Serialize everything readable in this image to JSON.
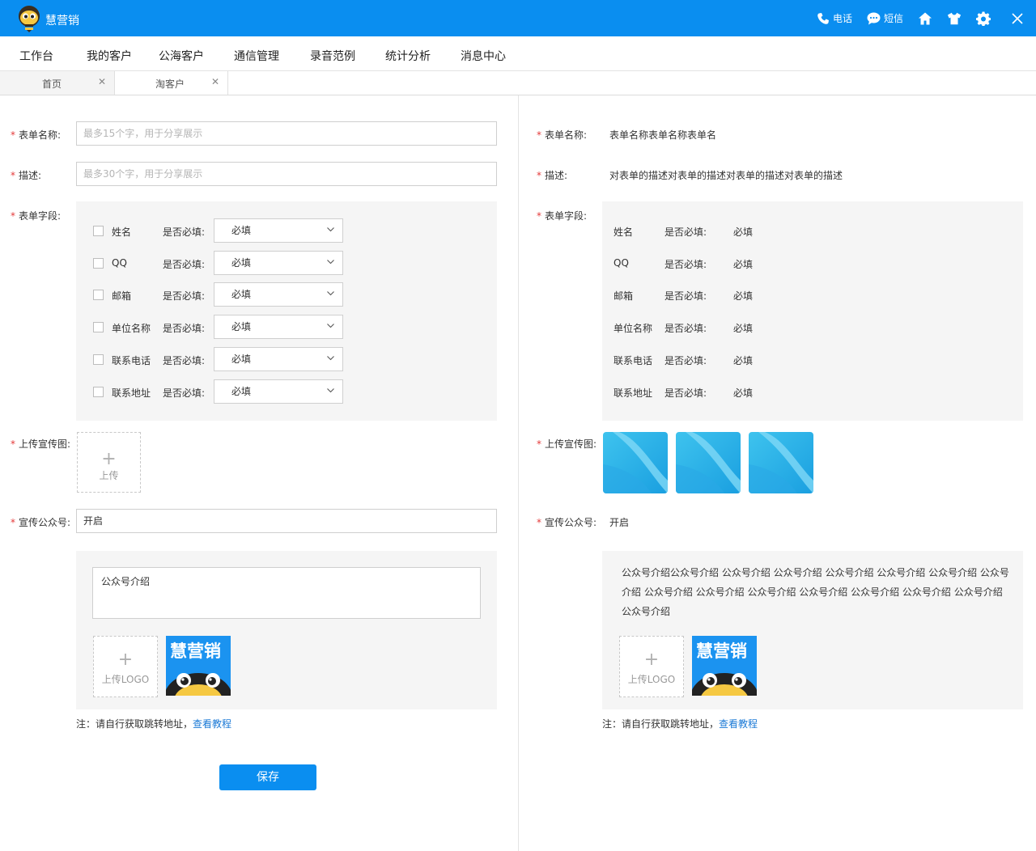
{
  "app": {
    "title": "慧营销"
  },
  "titlebar": {
    "phone_label": "电话",
    "sms_label": "短信",
    "colors": {
      "primary": "#0a8ef0"
    }
  },
  "nav": {
    "items": [
      "工作台",
      "我的客户",
      "公海客户",
      "通信管理",
      "录音范例",
      "统计分析",
      "消息中心"
    ]
  },
  "tabs": [
    {
      "label": "首页"
    },
    {
      "label": "淘客户"
    }
  ],
  "form": {
    "name_label": "表单名称:",
    "name_placeholder": "最多15个字，用于分享展示",
    "desc_label": "描述:",
    "desc_placeholder": "最多30个字，用于分享展示",
    "fields_label": "表单字段:",
    "required_label": "是否必填:",
    "fields": [
      {
        "name": "姓名",
        "required": "必填"
      },
      {
        "name": "QQ",
        "required": "必填"
      },
      {
        "name": "邮箱",
        "required": "必填"
      },
      {
        "name": "单位名称",
        "required": "必填"
      },
      {
        "name": "联系电话",
        "required": "必填"
      },
      {
        "name": "联系地址",
        "required": "必填"
      }
    ],
    "upload_label": "上传宣传图:",
    "upload_text": "上传",
    "public_label": "宣传公众号:",
    "public_value": "开启",
    "intro_value": "公众号介绍",
    "upload_logo_text": "上传LOGO",
    "logo_text": "慧营销",
    "note_text": "注：请自行获取跳转地址，",
    "note_link": "查看教程",
    "save_label": "保存"
  },
  "preview": {
    "name_label": "表单名称:",
    "name_value": "表单名称表单名称表单名",
    "desc_label": "描述:",
    "desc_value": "对表单的描述对表单的描述对表单的描述对表单的描述",
    "fields_label": "表单字段:",
    "required_label": "是否必填:",
    "fields": [
      {
        "name": "姓名",
        "required": "必填"
      },
      {
        "name": "QQ",
        "required": "必填"
      },
      {
        "name": "邮箱",
        "required": "必填"
      },
      {
        "name": "单位名称",
        "required": "必填"
      },
      {
        "name": "联系电话",
        "required": "必填"
      },
      {
        "name": "联系地址",
        "required": "必填"
      }
    ],
    "upload_label": "上传宣传图:",
    "public_label": "宣传公众号:",
    "public_value": "开启",
    "intro_text": "公众号介绍公众号介绍 公众号介绍 公众号介绍 公众号介绍 公众号介绍 公众号介绍 公众号介绍 公众号介绍 公众号介绍 公众号介绍 公众号介绍 公众号介绍 公众号介绍 公众号介绍 公众号介绍",
    "upload_logo_text": "上传LOGO",
    "logo_text": "慧营销",
    "note_text": "注：请自行获取跳转地址，",
    "note_link": "查看教程"
  }
}
